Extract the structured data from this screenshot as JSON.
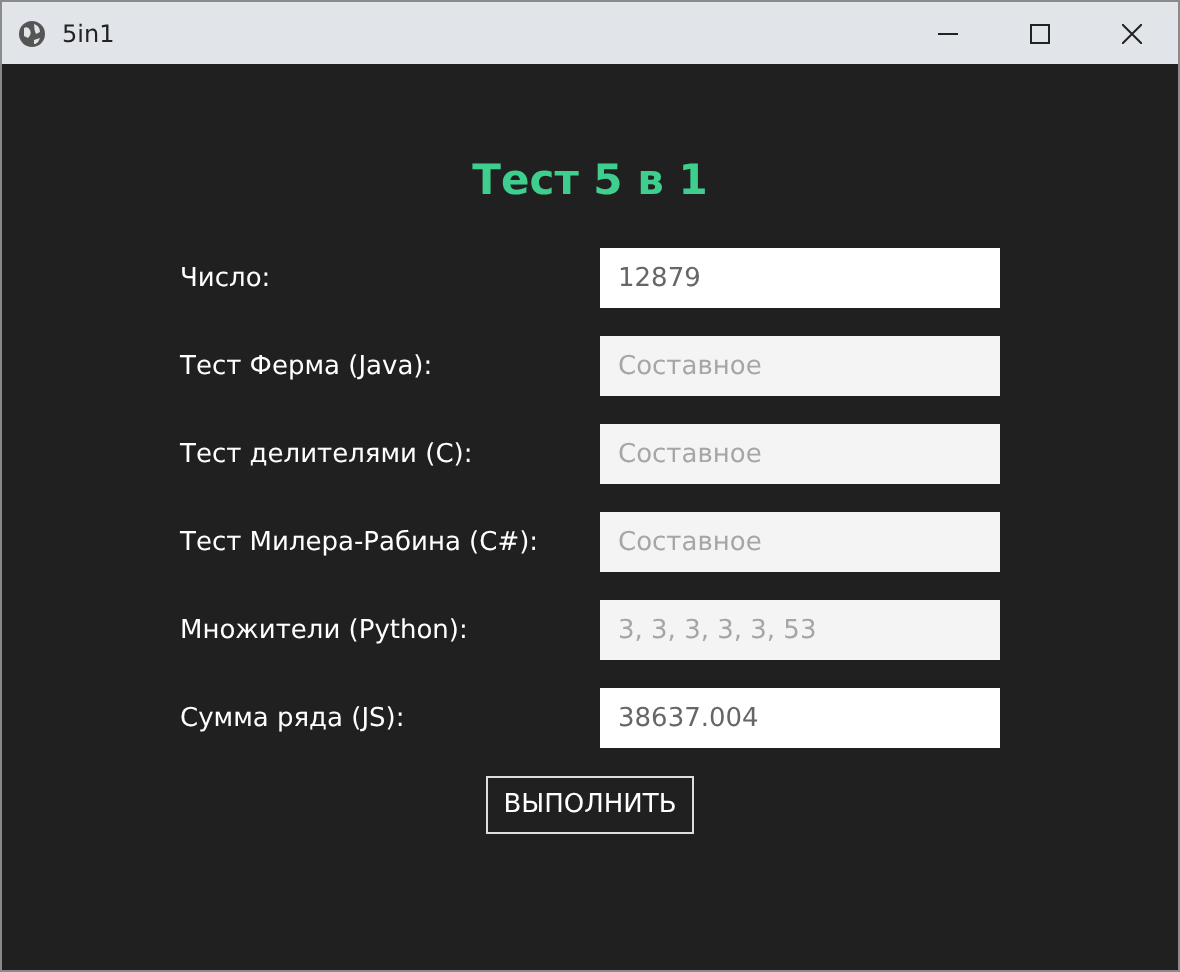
{
  "window": {
    "title": "5in1"
  },
  "heading": "Тест 5 в 1",
  "fields": [
    {
      "label": "Число:",
      "value": "12879",
      "disabled": false
    },
    {
      "label": "Тест Ферма (Java):",
      "value": "Составное",
      "disabled": true
    },
    {
      "label": "Тест делителями (C):",
      "value": "Составное",
      "disabled": true
    },
    {
      "label": "Тест Милера-Рабина (C#):",
      "value": "Составное",
      "disabled": true
    },
    {
      "label": "Множители (Python):",
      "value": "3, 3, 3, 3, 3, 53",
      "disabled": true
    },
    {
      "label": "Сумма ряда (JS):",
      "value": "38637.004",
      "disabled": false
    }
  ],
  "button": "ВЫПОЛНИТЬ"
}
